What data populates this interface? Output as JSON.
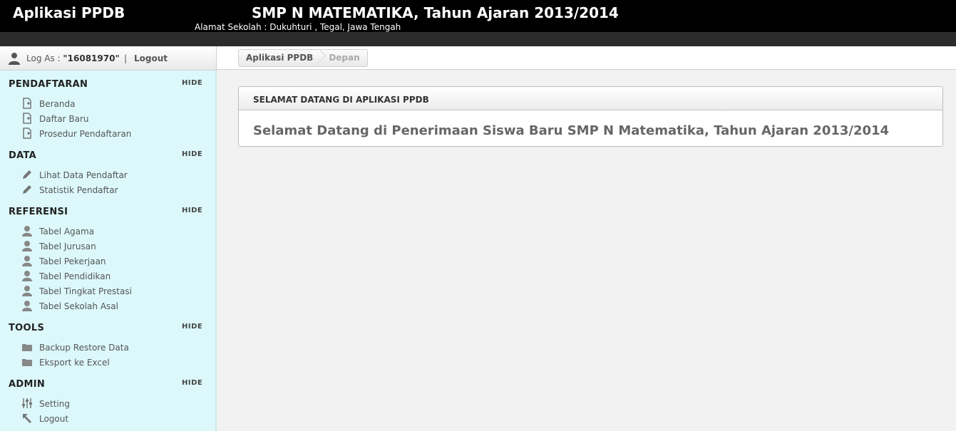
{
  "header": {
    "app_title": "Aplikasi PPDB",
    "school_title": "SMP N MATEMATIKA, Tahun Ajaran 2013/2014",
    "school_address": "Alamat Sekolah : Dukuhturi , Tegal, Jawa Tengah"
  },
  "userbar": {
    "login_prefix": "Log As : ",
    "username": "\"16081970\"",
    "separator": "|",
    "logout_label": "Logout",
    "icon": "user-icon"
  },
  "breadcrumb": {
    "home": "Aplikasi PPDB",
    "current": "Depan"
  },
  "sidebar": {
    "hide_label": "HIDE",
    "sections": [
      {
        "title": "PENDAFTARAN",
        "items": [
          {
            "label": "Beranda",
            "icon": "document-icon"
          },
          {
            "label": "Daftar Baru",
            "icon": "document-icon"
          },
          {
            "label": "Prosedur Pendaftaran",
            "icon": "document-icon"
          }
        ]
      },
      {
        "title": "DATA",
        "items": [
          {
            "label": "Lihat Data Pendaftar",
            "icon": "pencil-icon"
          },
          {
            "label": "Statistik Pendaftar",
            "icon": "pencil-icon"
          }
        ]
      },
      {
        "title": "REFERENSI",
        "items": [
          {
            "label": "Tabel Agama",
            "icon": "user-icon"
          },
          {
            "label": "Tabel Jurusan",
            "icon": "user-icon"
          },
          {
            "label": "Tabel Pekerjaan",
            "icon": "user-icon"
          },
          {
            "label": "Tabel Pendidikan",
            "icon": "user-icon"
          },
          {
            "label": "Tabel Tingkat Prestasi",
            "icon": "user-icon"
          },
          {
            "label": "Tabel Sekolah Asal",
            "icon": "user-icon"
          }
        ]
      },
      {
        "title": "TOOLS",
        "items": [
          {
            "label": "Backup Restore Data",
            "icon": "folder-icon"
          },
          {
            "label": "Eksport ke Excel",
            "icon": "folder-icon"
          }
        ]
      },
      {
        "title": "ADMIN",
        "items": [
          {
            "label": "Setting",
            "icon": "sliders-icon"
          },
          {
            "label": "Logout",
            "icon": "arrow-icon"
          }
        ]
      }
    ]
  },
  "main": {
    "panel_title": "SELAMAT DATANG DI APLIKASI PPDB",
    "welcome_text": "Selamat Datang di Penerimaan Siswa Baru SMP N Matematika, Tahun Ajaran 2013/2014"
  }
}
